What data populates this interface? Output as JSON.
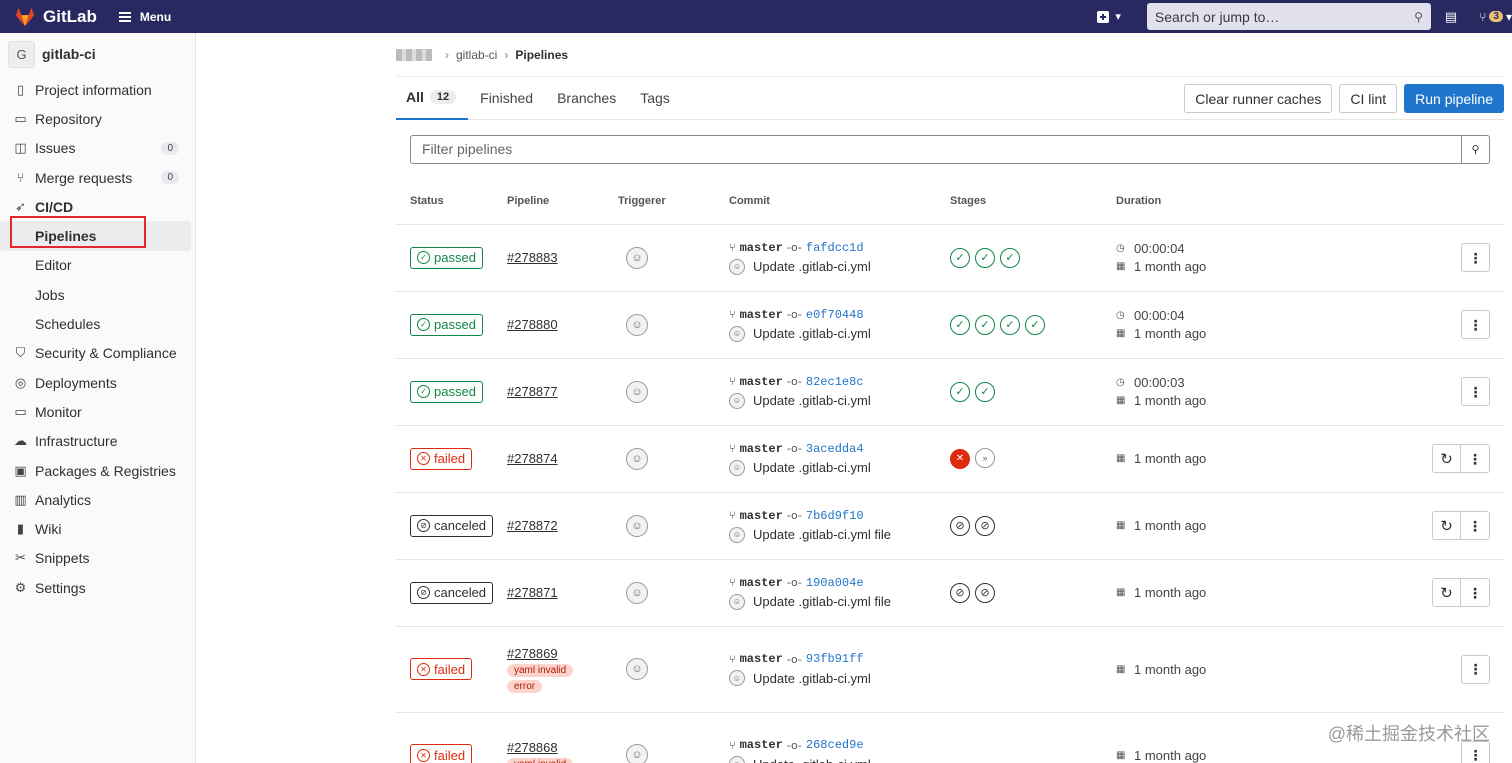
{
  "topbar": {
    "brand": "GitLab",
    "menu_label": "Menu",
    "search_placeholder": "Search or jump to…",
    "mr_count": "3"
  },
  "sidebar": {
    "project_initial": "G",
    "project_name": "gitlab-ci",
    "items": [
      {
        "label": "Project information",
        "icon": "info-icon"
      },
      {
        "label": "Repository",
        "icon": "book-icon"
      },
      {
        "label": "Issues",
        "icon": "issues-icon",
        "count": "0"
      },
      {
        "label": "Merge requests",
        "icon": "merge-request-icon",
        "count": "0"
      },
      {
        "label": "CI/CD",
        "icon": "rocket-icon"
      },
      {
        "label": "Pipelines"
      },
      {
        "label": "Editor"
      },
      {
        "label": "Jobs"
      },
      {
        "label": "Schedules"
      },
      {
        "label": "Security & Compliance",
        "icon": "shield-icon"
      },
      {
        "label": "Deployments",
        "icon": "deployments-icon"
      },
      {
        "label": "Monitor",
        "icon": "monitor-icon"
      },
      {
        "label": "Infrastructure",
        "icon": "cloud-icon"
      },
      {
        "label": "Packages & Registries",
        "icon": "package-icon"
      },
      {
        "label": "Analytics",
        "icon": "chart-icon"
      },
      {
        "label": "Wiki",
        "icon": "wiki-icon"
      },
      {
        "label": "Snippets",
        "icon": "scissors-icon"
      },
      {
        "label": "Settings",
        "icon": "gear-icon"
      }
    ]
  },
  "breadcrumb": {
    "project": "gitlab-ci",
    "current": "Pipelines"
  },
  "tabs": {
    "all": "All",
    "all_count": "12",
    "finished": "Finished",
    "branches": "Branches",
    "tags": "Tags"
  },
  "buttons": {
    "clear_caches": "Clear runner caches",
    "ci_lint": "CI lint",
    "run_pipeline": "Run pipeline"
  },
  "filter": {
    "placeholder": "Filter pipelines"
  },
  "table": {
    "headers": {
      "status": "Status",
      "pipeline": "Pipeline",
      "triggerer": "Triggerer",
      "commit": "Commit",
      "stages": "Stages",
      "duration": "Duration"
    }
  },
  "pipelines": [
    {
      "status": "passed",
      "id": "#278883",
      "branch": "master",
      "sha": "fafdcc1d",
      "message": "Update .gitlab-ci.yml",
      "stages": [
        "ok",
        "ok",
        "ok"
      ],
      "duration": "00:00:04",
      "finished": "1 month ago"
    },
    {
      "status": "passed",
      "id": "#278880",
      "branch": "master",
      "sha": "e0f70448",
      "message": "Update .gitlab-ci.yml",
      "stages": [
        "ok",
        "ok",
        "ok",
        "ok"
      ],
      "duration": "00:00:04",
      "finished": "1 month ago"
    },
    {
      "status": "passed",
      "id": "#278877",
      "branch": "master",
      "sha": "82ec1e8c",
      "message": "Update .gitlab-ci.yml",
      "stages": [
        "ok",
        "ok"
      ],
      "duration": "00:00:03",
      "finished": "1 month ago"
    },
    {
      "status": "failed",
      "id": "#278874",
      "branch": "master",
      "sha": "3acedda4",
      "message": "Update .gitlab-ci.yml",
      "stages": [
        "fail",
        "skip"
      ],
      "finished": "1 month ago"
    },
    {
      "status": "canceled",
      "id": "#278872",
      "branch": "master",
      "sha": "7b6d9f10",
      "message": "Update .gitlab-ci.yml file",
      "stages": [
        "cancel",
        "cancel"
      ],
      "finished": "1 month ago"
    },
    {
      "status": "canceled",
      "id": "#278871",
      "branch": "master",
      "sha": "190a004e",
      "message": "Update .gitlab-ci.yml file",
      "stages": [
        "cancel",
        "cancel"
      ],
      "finished": "1 month ago"
    },
    {
      "status": "failed",
      "id": "#278869",
      "badges": [
        "yaml invalid",
        "error"
      ],
      "branch": "master",
      "sha": "93fb91ff",
      "message": "Update .gitlab-ci.yml",
      "stages": [],
      "finished": "1 month ago"
    },
    {
      "status": "failed",
      "id": "#278868",
      "badges": [
        "yaml invalid"
      ],
      "branch": "master",
      "sha": "268ced9e",
      "message": "Update .gitlab-ci.yml",
      "stages": [],
      "finished": "1 month ago"
    }
  ],
  "watermark": "@稀土掘金技术社区"
}
